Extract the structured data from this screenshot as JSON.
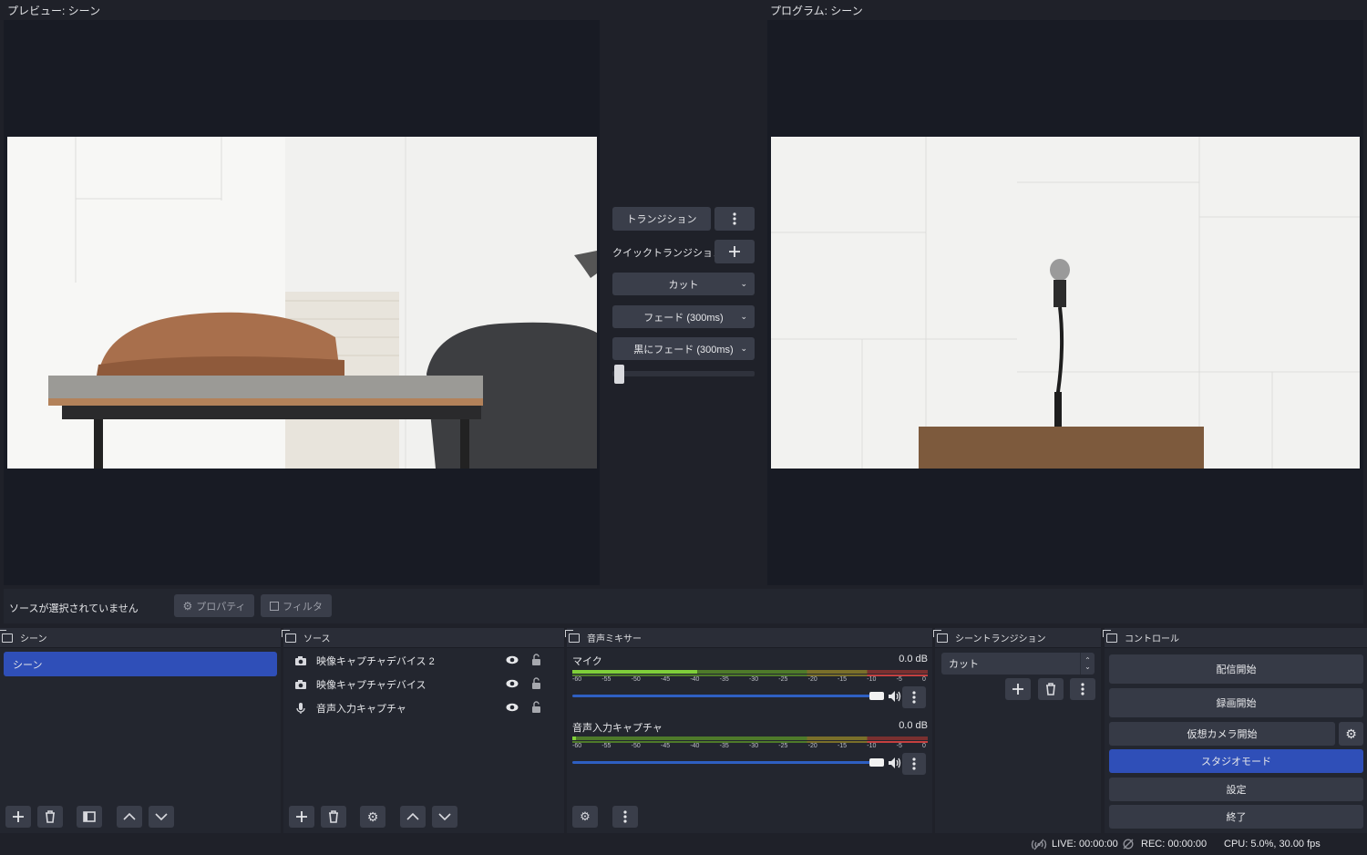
{
  "preview": {
    "title": "プレビュー: シーン"
  },
  "program": {
    "title": "プログラム: シーン"
  },
  "transition_panel": {
    "transition_label": "トランジション",
    "quick_transition_label": "クイックトランジション",
    "items": [
      "カット",
      "フェード (300ms)",
      "黒にフェード (300ms)"
    ]
  },
  "source_bar": {
    "status": "ソースが選択されていません",
    "properties_label": "プロパティ",
    "filters_label": "フィルタ"
  },
  "scenes_dock": {
    "title": "シーン",
    "items": [
      "シーン"
    ]
  },
  "sources_dock": {
    "title": "ソース",
    "items": [
      {
        "label": "映像キャプチャデバイス 2",
        "icon": "camera-icon"
      },
      {
        "label": "映像キャプチャデバイス",
        "icon": "camera-icon"
      },
      {
        "label": "音声入力キャプチャ",
        "icon": "microphone-icon"
      }
    ]
  },
  "mixer_dock": {
    "title": "音声ミキサー",
    "channels": [
      {
        "name": "マイク",
        "db": "0.0 dB",
        "volume": 1.0
      },
      {
        "name": "音声入力キャプチャ",
        "db": "0.0 dB",
        "volume": 1.0
      }
    ],
    "scale": [
      "-60",
      "-55",
      "-50",
      "-45",
      "-40",
      "-35",
      "-30",
      "-25",
      "-20",
      "-15",
      "-10",
      "-5",
      "0"
    ]
  },
  "scene_transition_dock": {
    "title": "シーントランジション",
    "selected": "カット"
  },
  "controls_dock": {
    "title": "コントロール",
    "start_streaming": "配信開始",
    "start_recording": "録画開始",
    "start_virtual_camera": "仮想カメラ開始",
    "studio_mode": "スタジオモード",
    "settings": "設定",
    "exit": "終了"
  },
  "status_bar": {
    "live": "LIVE: 00:00:00",
    "rec": "REC: 00:00:00",
    "cpu": "CPU: 5.0%, 30.00 fps"
  },
  "colors": {
    "accent": "#2f4fb8",
    "background": "#1f2129",
    "panel": "#2a2d37"
  }
}
